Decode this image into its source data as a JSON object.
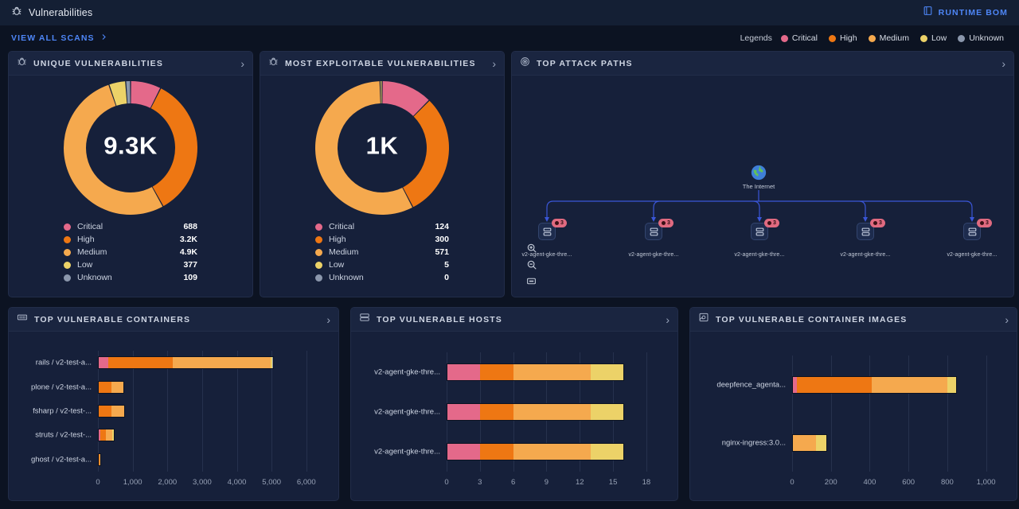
{
  "topbar": {
    "icon": "bug-icon",
    "title": "Vulnerabilities",
    "runtime_bom_label": "RUNTIME BOM",
    "runtime_bom_icon": "document-icon"
  },
  "toolbar": {
    "view_all_scans_label": "VIEW ALL SCANS",
    "chevron": "›",
    "legends_label": "Legends",
    "legends": [
      {
        "label": "Critical",
        "color": "#e4698a"
      },
      {
        "label": "High",
        "color": "#ee7713"
      },
      {
        "label": "Medium",
        "color": "#f5a94e"
      },
      {
        "label": "Low",
        "color": "#ecd268"
      },
      {
        "label": "Unknown",
        "color": "#8b97ac"
      }
    ]
  },
  "severity_colors": {
    "critical": "#e4698a",
    "high": "#ee7713",
    "medium": "#f5a94e",
    "low": "#ecd268",
    "unknown": "#8b97ac"
  },
  "unique_vulnerabilities": {
    "title": "UNIQUE VULNERABILITIES",
    "icon": "bug-icon",
    "chevron": "›",
    "total_label": "9.3K",
    "chart_data": {
      "type": "pie",
      "title": "Unique Vulnerabilities",
      "categories": [
        "Critical",
        "High",
        "Medium",
        "Low",
        "Unknown"
      ],
      "values": [
        688,
        3200,
        4900,
        377,
        109
      ],
      "labels": [
        "688",
        "3.2K",
        "4.9K",
        "377",
        "109"
      ],
      "colors": [
        "#e4698a",
        "#ee7713",
        "#f5a94e",
        "#ecd268",
        "#8b97ac"
      ],
      "center_text": "9.3K",
      "legend_position": "bottom"
    }
  },
  "most_exploitable": {
    "title": "MOST EXPLOITABLE VULNERABILITIES",
    "icon": "bug-icon",
    "chevron": "›",
    "total_label": "1K",
    "chart_data": {
      "type": "pie",
      "title": "Most Exploitable Vulnerabilities",
      "categories": [
        "Critical",
        "High",
        "Medium",
        "Low",
        "Unknown"
      ],
      "values": [
        124,
        300,
        571,
        5,
        0
      ],
      "labels": [
        "124",
        "300",
        "571",
        "5",
        "0"
      ],
      "colors": [
        "#e4698a",
        "#ee7713",
        "#f5a94e",
        "#ecd268",
        "#8b97ac"
      ],
      "center_text": "1K",
      "legend_position": "bottom"
    }
  },
  "attack_paths": {
    "title": "TOP ATTACK PATHS",
    "icon": "radar-icon",
    "chevron": "›",
    "root": {
      "label": "The Internet",
      "icon": "globe-icon"
    },
    "nodes": [
      {
        "label": "v2-agent-gke-thre...",
        "badge": "3",
        "icon": "host-icon"
      },
      {
        "label": "v2-agent-gke-thre...",
        "badge": "3",
        "icon": "host-icon"
      },
      {
        "label": "v2-agent-gke-thre...",
        "badge": "3",
        "icon": "host-icon"
      },
      {
        "label": "v2-agent-gke-thre...",
        "badge": "3",
        "icon": "host-icon"
      },
      {
        "label": "v2-agent-gke-thre...",
        "badge": "3",
        "icon": "host-icon"
      }
    ],
    "controls": [
      {
        "name": "zoom-in-icon"
      },
      {
        "name": "zoom-out-icon"
      },
      {
        "name": "fit-view-icon"
      }
    ]
  },
  "top_vulnerable_containers": {
    "title": "TOP VULNERABLE CONTAINERS",
    "icon": "container-icon",
    "chevron": "›",
    "chart_data": {
      "type": "bar",
      "orientation": "horizontal",
      "stacked": true,
      "title": "Top Vulnerable Containers",
      "categories": [
        "rails / v2-test-a...",
        "plone / v2-test-a...",
        "fsharp / v2-test-...",
        "struts / v2-test-...",
        "ghost / v2-test-a..."
      ],
      "series": [
        {
          "name": "Critical",
          "color": "#e4698a",
          "values": [
            270,
            0,
            0,
            60,
            0
          ]
        },
        {
          "name": "High",
          "color": "#ee7713",
          "values": [
            1880,
            390,
            380,
            160,
            60
          ]
        },
        {
          "name": "Medium",
          "color": "#f5a94e",
          "values": [
            2840,
            370,
            400,
            220,
            40
          ]
        },
        {
          "name": "Low",
          "color": "#ecd268",
          "values": [
            40,
            0,
            0,
            30,
            0
          ]
        },
        {
          "name": "Unknown",
          "color": "#8b97ac",
          "values": [
            30,
            0,
            0,
            0,
            0
          ]
        }
      ],
      "xticks": [
        0,
        1000,
        2000,
        3000,
        4000,
        5000,
        6000
      ],
      "xtick_labels": [
        "0",
        "1,000",
        "2,000",
        "3,000",
        "4,000",
        "5,000",
        "6,000"
      ],
      "xlim": [
        0,
        6600
      ],
      "xlabel": "",
      "ylabel": ""
    }
  },
  "top_vulnerable_hosts": {
    "title": "TOP VULNERABLE HOSTS",
    "icon": "host-icon",
    "chevron": "›",
    "chart_data": {
      "type": "bar",
      "orientation": "horizontal",
      "stacked": true,
      "title": "Top Vulnerable Hosts",
      "categories": [
        "v2-agent-gke-thre...",
        "v2-agent-gke-thre...",
        "v2-agent-gke-thre..."
      ],
      "series": [
        {
          "name": "Critical",
          "color": "#e4698a",
          "values": [
            3,
            3,
            3
          ]
        },
        {
          "name": "High",
          "color": "#ee7713",
          "values": [
            3,
            3,
            3
          ]
        },
        {
          "name": "Medium",
          "color": "#f5a94e",
          "values": [
            7,
            7,
            7
          ]
        },
        {
          "name": "Low",
          "color": "#ecd268",
          "values": [
            3,
            3,
            3
          ]
        }
      ],
      "xticks": [
        0,
        3,
        6,
        9,
        12,
        15,
        18
      ],
      "xtick_labels": [
        "0",
        "3",
        "6",
        "9",
        "12",
        "15",
        "18"
      ],
      "xlim": [
        0,
        19.8
      ],
      "xlabel": "",
      "ylabel": ""
    }
  },
  "top_vulnerable_images": {
    "title": "TOP VULNERABLE CONTAINER IMAGES",
    "icon": "image-icon",
    "chevron": "›",
    "chart_data": {
      "type": "bar",
      "orientation": "horizontal",
      "stacked": true,
      "title": "Top Vulnerable Container Images",
      "categories": [
        "deepfence_agenta...",
        "nginx-ingress:3.0..."
      ],
      "series": [
        {
          "name": "Critical",
          "color": "#e4698a",
          "values": [
            22,
            0
          ]
        },
        {
          "name": "High",
          "color": "#ee7713",
          "values": [
            390,
            0
          ]
        },
        {
          "name": "Medium",
          "color": "#f5a94e",
          "values": [
            393,
            125
          ]
        },
        {
          "name": "Low",
          "color": "#ecd268",
          "values": [
            45,
            55
          ]
        }
      ],
      "xticks": [
        0,
        200,
        400,
        600,
        800,
        1000
      ],
      "xtick_labels": [
        "0",
        "200",
        "400",
        "600",
        "800",
        "1,000"
      ],
      "xlim": [
        0,
        1100
      ],
      "xlabel": "",
      "ylabel": ""
    }
  }
}
